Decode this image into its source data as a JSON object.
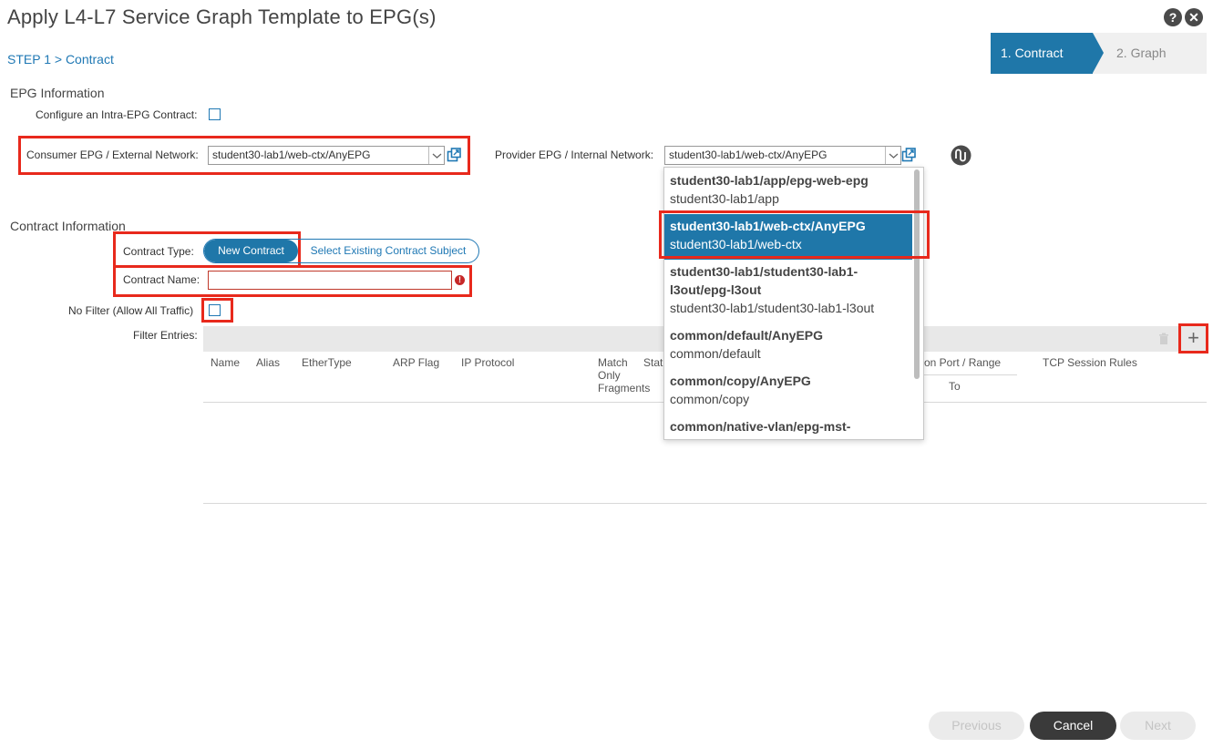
{
  "dialog": {
    "title": "Apply L4-L7 Service Graph Template to EPG(s)",
    "help_glyph": "?",
    "close_glyph": "✕"
  },
  "step_title": "STEP 1 > Contract",
  "wizard": {
    "steps": [
      {
        "label": "1. Contract",
        "active": true
      },
      {
        "label": "2. Graph",
        "active": false
      }
    ]
  },
  "epg_info": {
    "heading": "EPG Information",
    "intra_epg_label": "Configure an Intra-EPG Contract:",
    "consumer_label": "Consumer EPG / External Network:",
    "consumer_value": "student30-lab1/web-ctx/AnyEPG",
    "provider_label": "Provider EPG / Internal Network:",
    "provider_value": "student30-lab1/web-ctx/AnyEPG"
  },
  "contract_info": {
    "heading": "Contract Information",
    "type_label": "Contract Type:",
    "type_options": [
      "New Contract",
      "Select Existing Contract Subject"
    ],
    "type_selected": "New Contract",
    "name_label": "Contract Name:",
    "name_value": "",
    "no_filter_label": "No Filter (Allow All Traffic)",
    "filter_entries_label": "Filter Entries:"
  },
  "filter_table": {
    "columns": [
      "Name",
      "Alias",
      "EtherType",
      "ARP Flag",
      "IP Protocol",
      "Match Only Fragments",
      "Stat",
      "tion Port / Range",
      "TCP Session Rules"
    ],
    "match_lines": [
      "Match",
      "Only",
      "Fragments"
    ],
    "sub_to": "To",
    "add_glyph": "+"
  },
  "dropdown": {
    "options": [
      {
        "name": "student30-lab1/app/epg-web-epg",
        "name2": "",
        "path": "student30-lab1/app",
        "selected": false
      },
      {
        "name": "student30-lab1/web-ctx/AnyEPG",
        "name2": "",
        "path": "student30-lab1/web-ctx",
        "selected": true
      },
      {
        "name": "student30-lab1/student30-lab1-",
        "name2": "l3out/epg-l3out",
        "path": "student30-lab1/student30-lab1-l3out",
        "selected": false
      },
      {
        "name": "common/default/AnyEPG",
        "name2": "",
        "path": "common/default",
        "selected": false
      },
      {
        "name": "common/copy/AnyEPG",
        "name2": "",
        "path": "common/copy",
        "selected": false
      },
      {
        "name": "common/native-vlan/epg-mst-",
        "name2": "",
        "path": "",
        "selected": false
      }
    ]
  },
  "footer": {
    "previous": "Previous",
    "cancel": "Cancel",
    "next": "Next"
  },
  "colors": {
    "accent": "#1f77a9",
    "highlight_box": "#e8291c",
    "error": "#c62828"
  }
}
